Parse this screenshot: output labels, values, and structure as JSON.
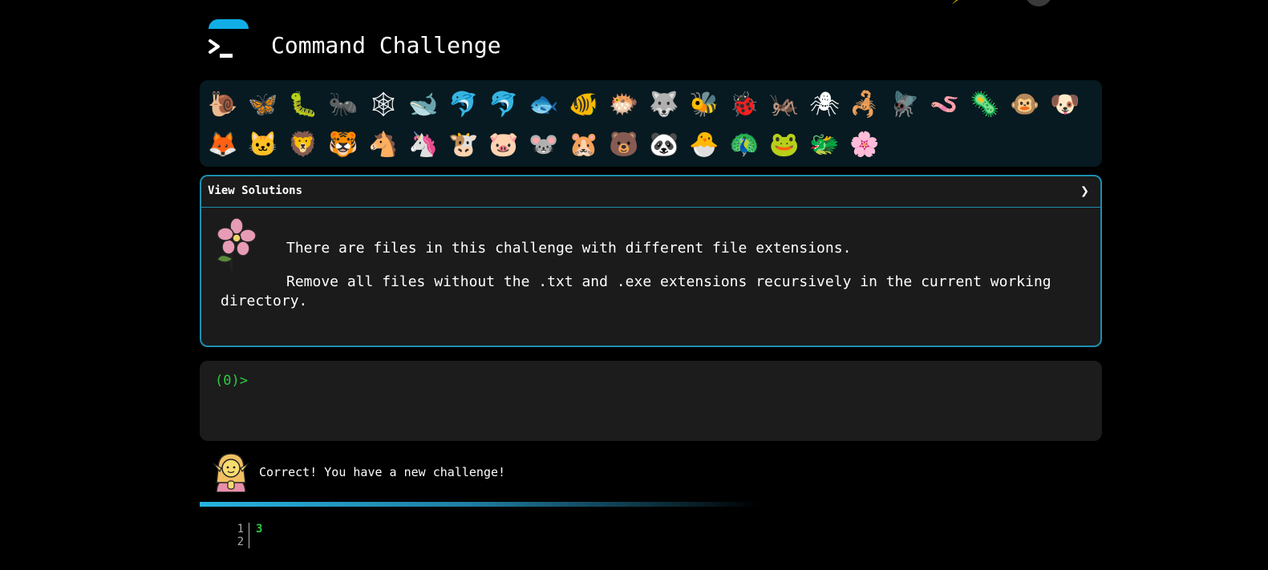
{
  "header": {
    "title": "Command Challenge",
    "logo_icon": "terminal-prompt-icon",
    "brand_color": "#11aee6"
  },
  "animals": {
    "row1": [
      "🐌",
      "🦋",
      "🐛",
      "🐜",
      "🕸",
      "🐋",
      "🐬",
      "🐬",
      "🐟",
      "🐠",
      "🐡",
      "🐺",
      "🐝",
      "🐞",
      "🦗",
      "🕷",
      "🦂",
      "🪰",
      "🪱",
      "🦠",
      "🐵",
      "🐶"
    ],
    "row2": [
      "🦊",
      "🐱",
      "🦁",
      "🐯",
      "🐴",
      "🦄",
      "🐮",
      "🐷",
      "🐭",
      "🐹",
      "🐻",
      "🐼",
      "🐣",
      "🦚",
      "🐸",
      "🐲",
      "🌸"
    ]
  },
  "solutions": {
    "label": "View Solutions",
    "chevron": "❯",
    "flower_icon": "flower-icon",
    "paragraphs": [
      "There are files in this challenge with different file extensions.",
      "Remove all files without the .txt and .exe extensions recursively in the current working directory."
    ]
  },
  "terminal": {
    "prompt": "(0)>"
  },
  "feedback": {
    "icon": "elf-icon",
    "message": "Correct! You have a new challenge!"
  },
  "code": {
    "line_numbers": [
      "1",
      "2"
    ],
    "lines": [
      "3",
      ""
    ]
  }
}
